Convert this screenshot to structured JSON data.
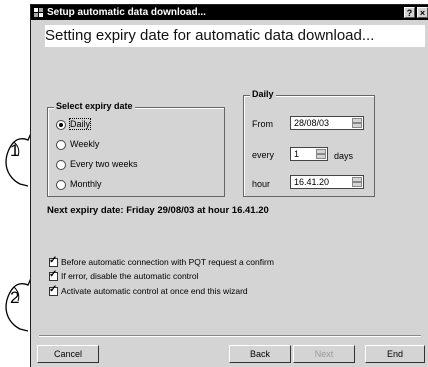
{
  "window": {
    "title": "Setup automatic data download...",
    "help_btn": "?",
    "close_btn": "×"
  },
  "heading": "Setting expiry date for automatic data download...",
  "expiry": {
    "group_title": "Select expiry date",
    "options": [
      {
        "label": "Daily",
        "selected": true
      },
      {
        "label": "Weekly",
        "selected": false
      },
      {
        "label": "Every two weeks",
        "selected": false
      },
      {
        "label": "Monthly",
        "selected": false
      }
    ]
  },
  "daily": {
    "group_title": "Daily",
    "from_label": "From",
    "from_value": "28/08/03",
    "every_label": "every",
    "every_value": "1",
    "days_label": "days",
    "hour_label": "hour",
    "hour_value": "16.41.20"
  },
  "next_expiry": "Next expiry date: Friday 29/08/03 at hour 16.41.20",
  "checkboxes": [
    {
      "label": "Before automatic connection with PQT request a confirm",
      "checked": true
    },
    {
      "label": "If error, disable the automatic control",
      "checked": true
    },
    {
      "label": "Activate automatic control at once end this wizard",
      "checked": true
    }
  ],
  "buttons": {
    "cancel": "Cancel",
    "back": "Back",
    "next": "Next",
    "end": "End"
  },
  "callouts": [
    "1",
    "2"
  ],
  "icons": {
    "check_mark": "✓"
  }
}
